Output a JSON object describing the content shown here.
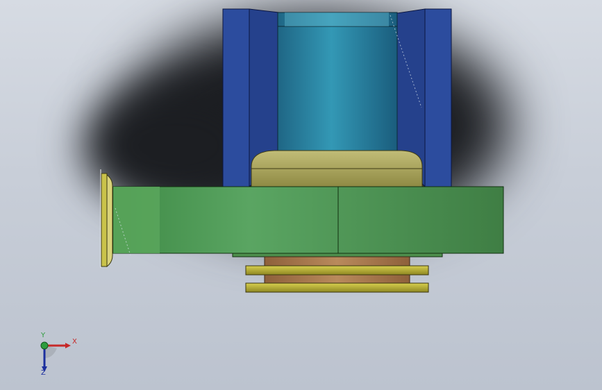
{
  "viewport": {
    "background_color": "#c8ced8",
    "shadow_color": "#1c1e22"
  },
  "model": {
    "housing_color": "#2b4b9b",
    "cylinder_color": "#2a7f9c",
    "cap_color": "#a8a35c",
    "base_plate_color": "#4f9e56",
    "edge_clamp_color": "#b9b344",
    "washer_color": "#c2b93a",
    "spacer_color": "#a7784c"
  },
  "triad": {
    "x_label": "X",
    "y_label": "Y",
    "z_label": "Z",
    "x_color": "#c62828",
    "y_color": "#2e9d3e",
    "z_color": "#1c2f9e"
  }
}
